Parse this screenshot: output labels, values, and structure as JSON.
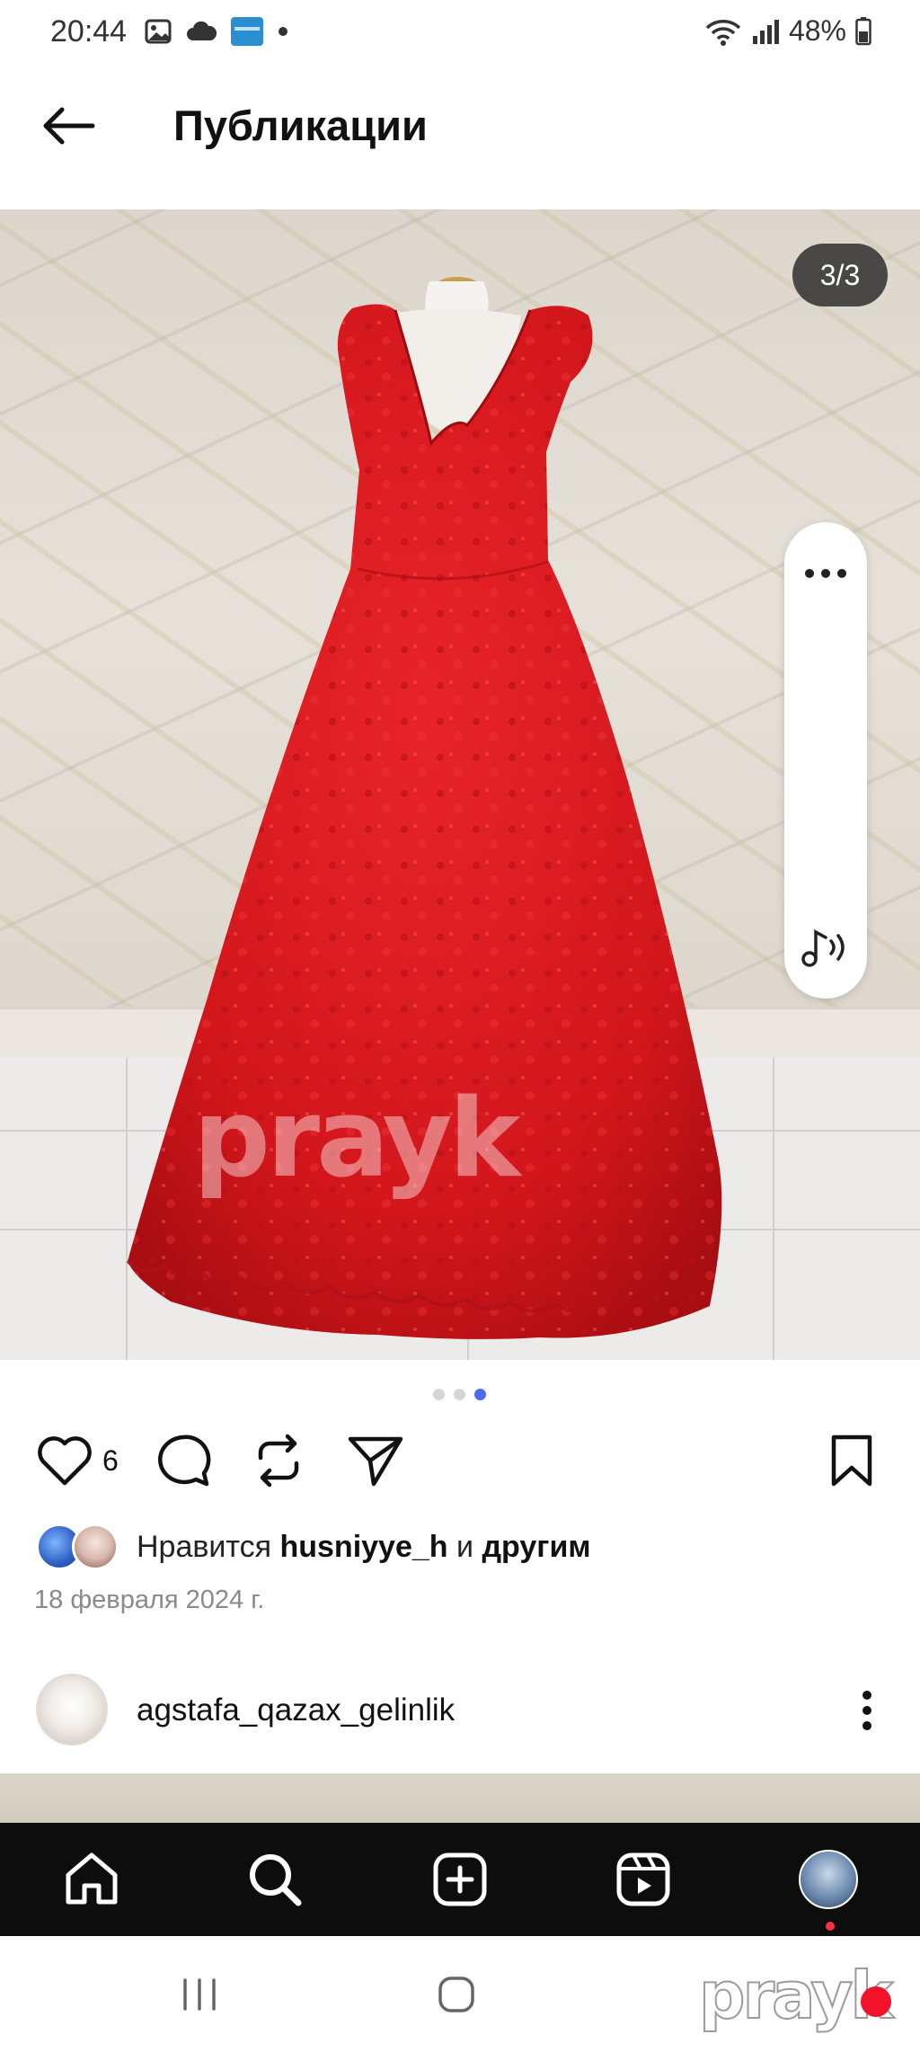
{
  "status_bar": {
    "time": "20:44",
    "battery": "48%",
    "icons": [
      "image-icon",
      "cloud-icon",
      "app-notification-icon",
      "dot-icon",
      "wifi-icon",
      "signal-icon",
      "battery-icon"
    ]
  },
  "header": {
    "title": "Публикации",
    "back_icon": "arrow-left-icon"
  },
  "post": {
    "media_counter": "3/3",
    "watermark": "prayk",
    "carousel": {
      "total": 3,
      "active_index": 2
    },
    "like_count": "6",
    "likes": {
      "prefix": "Нравится",
      "user": "husniyye_h",
      "conjunction": "и",
      "suffix": "другим"
    },
    "date": "18 февраля 2024 г."
  },
  "next_post": {
    "author": "agstafa_qazax_gelinlik"
  },
  "bottom_nav": {
    "items": [
      "home-icon",
      "search-icon",
      "create-icon",
      "reels-icon",
      "profile-avatar"
    ]
  },
  "system_nav": {
    "watermark": "prayk"
  },
  "colors": {
    "accent_dot": "#4a6cf0",
    "dress": "#d9181c",
    "nav_bg": "#0d0d0d",
    "notification": "#ff3040"
  }
}
